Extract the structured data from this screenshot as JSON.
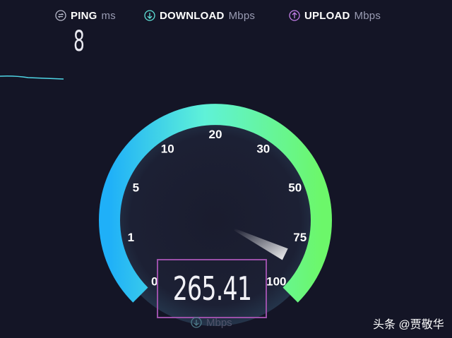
{
  "metrics": {
    "ping": {
      "label": "PING",
      "unit": "ms",
      "value": "8",
      "icon": "ping-icon"
    },
    "download": {
      "label": "DOWNLOAD",
      "unit": "Mbps",
      "icon": "download-arrow-icon"
    },
    "upload": {
      "label": "UPLOAD",
      "unit": "Mbps",
      "icon": "upload-arrow-icon"
    }
  },
  "gauge": {
    "value": "265.41",
    "unit": "Mbps",
    "ticks": [
      "0",
      "1",
      "5",
      "10",
      "20",
      "30",
      "50",
      "75",
      "100"
    ],
    "needle_position_fraction": 0.93,
    "colors": {
      "start": "#2bb9f5",
      "mid": "#5ff0d2",
      "end": "#6bf56b",
      "highlight": "#9a50a8"
    }
  },
  "watermark": "头条 @贾敬华"
}
